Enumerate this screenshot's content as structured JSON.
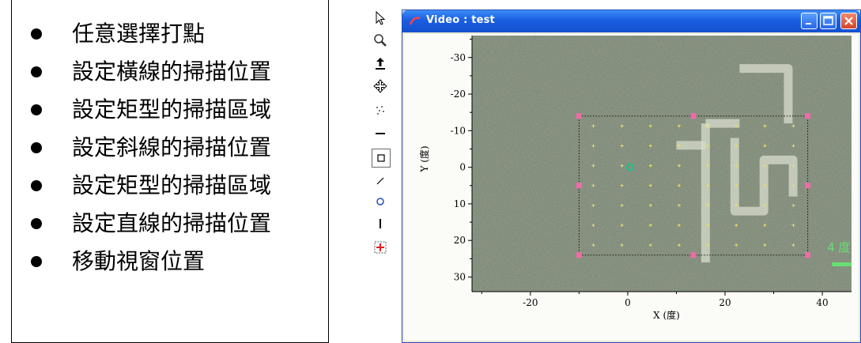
{
  "bullets": [
    "任意選擇打點",
    "設定橫線的掃描位置",
    "設定矩型的掃描區域",
    "設定斜線的掃描位置",
    "設定矩型的掃描區域",
    "設定直線的掃描位置",
    "移動視窗位置"
  ],
  "toolbar": {
    "tools": [
      "pointer-icon",
      "zoom-icon",
      "vertical-move-icon",
      "move-icon",
      "points-icon",
      "hline-icon",
      "rectangle-icon",
      "diagonal-line-icon",
      "circle-icon",
      "vline-icon",
      "move-window-icon"
    ],
    "selected": "rectangle-icon"
  },
  "window": {
    "title": "Video : test",
    "colors": {
      "titlebar": "#1a5ee0",
      "close": "#d4432a"
    }
  },
  "chart_data": {
    "type": "scatter",
    "xlabel": "X (度)",
    "ylabel": "Y (度)",
    "xticks": [
      -20,
      0,
      20,
      40
    ],
    "yticks": [
      -30,
      -20,
      -10,
      0,
      10,
      20,
      30
    ],
    "xlim": [
      -32,
      46
    ],
    "ylim": [
      -36,
      34
    ],
    "y_inverted": true,
    "scale_label": "4 度",
    "scan_rectangle": {
      "x": [
        -10,
        37
      ],
      "y": [
        -14,
        24
      ]
    },
    "marker_point": {
      "x": 0.5,
      "y": 0
    },
    "colors": {
      "handles": "#f06aa8",
      "marker": "#19c08a",
      "scale_bar": "#66e070"
    }
  }
}
